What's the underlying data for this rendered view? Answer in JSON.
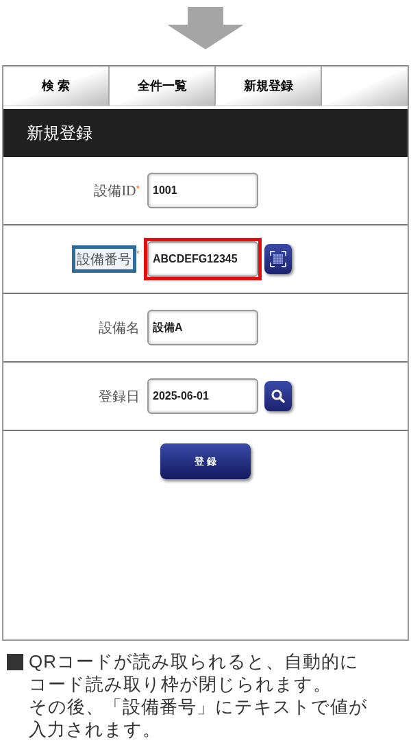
{
  "tabs": [
    {
      "label": "検 索"
    },
    {
      "label": "全件一覧"
    },
    {
      "label": "新規登録"
    }
  ],
  "section_title": "新規登録",
  "fields": [
    {
      "label": "設備ID",
      "required_mark": "*",
      "value": "1001",
      "highlighted": false,
      "kind": "text"
    },
    {
      "label": "設備番号",
      "required_mark": "*",
      "value": "ABCDEFG12345",
      "highlighted": true,
      "kind": "qr"
    },
    {
      "label": "設備名",
      "value": "設備A",
      "highlighted": false,
      "kind": "text"
    },
    {
      "label": "登録日",
      "value": "2025-06-01",
      "highlighted": false,
      "kind": "search"
    }
  ],
  "submit_button": "登 録",
  "caption": {
    "lines": [
      "QRコードが読み取られると、自動的に",
      "コード読み取り枠が閉じられます。",
      "その後、「設備番号」にテキストで値が",
      "入力されます。"
    ]
  }
}
